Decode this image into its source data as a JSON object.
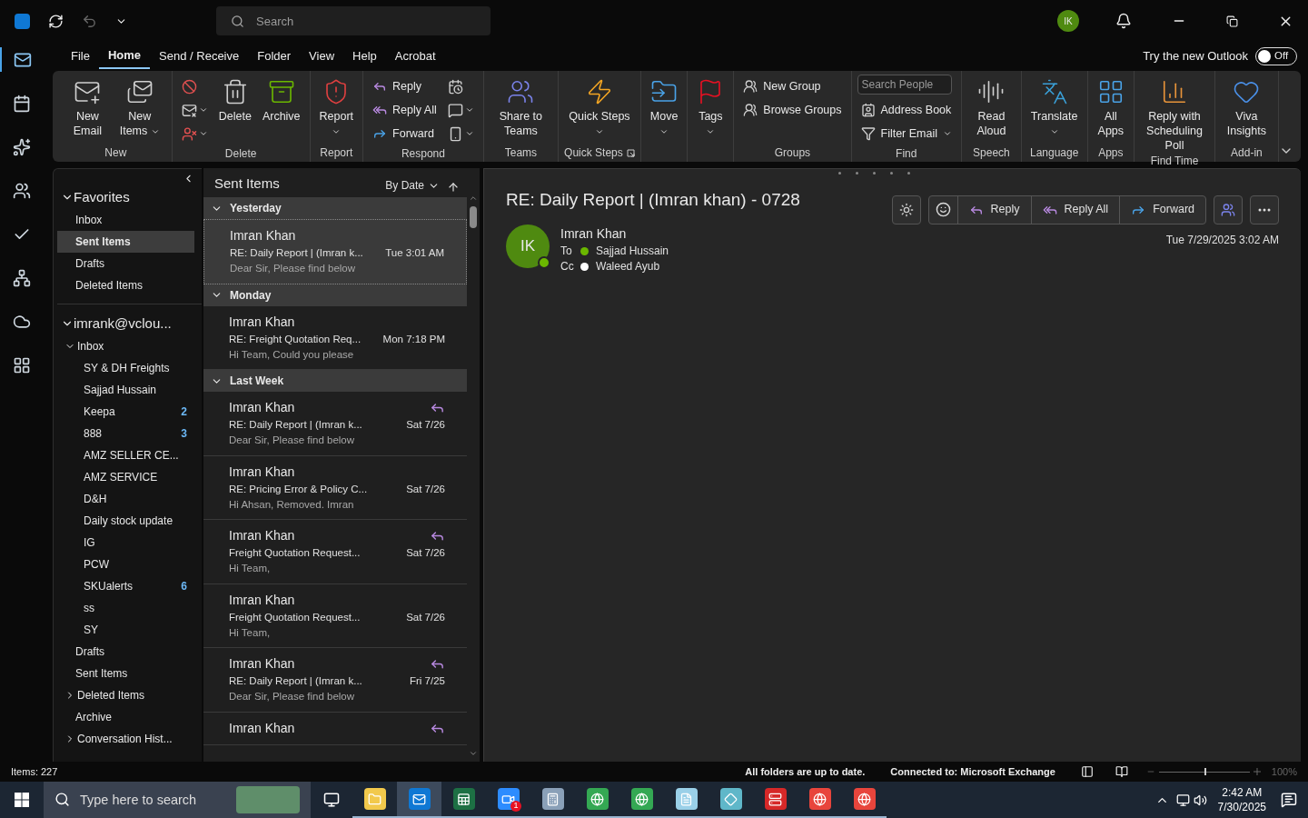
{
  "title_bar": {
    "search_placeholder": "Search",
    "avatar": "IK"
  },
  "menu_tabs": [
    {
      "label": "File",
      "selected": false
    },
    {
      "label": "Home",
      "selected": true
    },
    {
      "label": "Send / Receive",
      "selected": false
    },
    {
      "label": "Folder",
      "selected": false
    },
    {
      "label": "View",
      "selected": false
    },
    {
      "label": "Help",
      "selected": false
    },
    {
      "label": "Acrobat",
      "selected": false
    }
  ],
  "new_outlook_toggle": {
    "label": "Try the new Outlook",
    "state": "Off",
    "on": false
  },
  "ribbon": {
    "groups": [
      {
        "name": "New",
        "columns": [
          [
            {
              "kind": "large",
              "label": "New Email",
              "dropdown": false
            }
          ],
          [
            {
              "kind": "large",
              "label": "New Items",
              "dropdown": true
            }
          ]
        ]
      },
      {
        "name": "Delete",
        "columns": [
          [
            {
              "kind": "icon",
              "dropdown": false
            },
            {
              "kind": "icon",
              "dropdown": true
            },
            {
              "kind": "icon",
              "dropdown": true
            }
          ],
          [
            {
              "kind": "large",
              "label": "Delete",
              "dropdown": false
            }
          ],
          [
            {
              "kind": "large",
              "label": "Archive",
              "dropdown": false
            }
          ]
        ]
      },
      {
        "name": "Report",
        "columns": [
          [
            {
              "kind": "large",
              "label": "Report",
              "dropdown": true
            }
          ]
        ]
      },
      {
        "name": "Respond",
        "columns": [
          [
            {
              "kind": "small",
              "label": "Reply",
              "dropdown": false
            },
            {
              "kind": "small",
              "label": "Reply All",
              "dropdown": false
            },
            {
              "kind": "small",
              "label": "Forward",
              "dropdown": false
            }
          ],
          [
            {
              "kind": "icon",
              "dropdown": false
            },
            {
              "kind": "icon",
              "dropdown": true
            },
            {
              "kind": "icon",
              "dropdown": true
            }
          ]
        ]
      },
      {
        "name": "Teams",
        "columns": [
          [
            {
              "kind": "large",
              "label": "Share to Teams",
              "dropdown": false
            }
          ]
        ]
      },
      {
        "name": "Quick Steps",
        "launcher": true,
        "columns": [
          [
            {
              "kind": "large",
              "label": "Quick Steps",
              "dropdown": true
            }
          ]
        ]
      },
      {
        "columns": [
          [
            {
              "kind": "large",
              "label": "Move",
              "dropdown": true
            }
          ]
        ]
      },
      {
        "columns": [
          [
            {
              "kind": "large",
              "label": "Tags",
              "dropdown": true
            }
          ]
        ]
      },
      {
        "name": "Groups",
        "columns": [
          [
            {
              "kind": "small",
              "label": "New Group",
              "dropdown": false
            },
            {
              "kind": "small",
              "label": "Browse Groups",
              "dropdown": false
            }
          ]
        ]
      },
      {
        "name": "Find",
        "columns": [
          [
            {
              "kind": "field",
              "placeholder": "Search People"
            },
            {
              "kind": "small",
              "label": "Address Book",
              "dropdown": false
            },
            {
              "kind": "small",
              "label": "Filter Email",
              "dropdown": true
            }
          ]
        ]
      },
      {
        "name": "Speech",
        "columns": [
          [
            {
              "kind": "large",
              "label": "Read Aloud",
              "dropdown": false
            }
          ]
        ]
      },
      {
        "name": "Language",
        "columns": [
          [
            {
              "kind": "large",
              "label": "Translate",
              "dropdown": true
            }
          ]
        ]
      },
      {
        "name": "Apps",
        "columns": [
          [
            {
              "kind": "large",
              "label": "All Apps",
              "dropdown": false
            }
          ]
        ]
      },
      {
        "name": "Find Time",
        "columns": [
          [
            {
              "kind": "large",
              "label": "Reply with Scheduling Poll",
              "dropdown": false
            }
          ]
        ]
      },
      {
        "name": "Add-in",
        "columns": [
          [
            {
              "kind": "large",
              "label": "Viva Insights",
              "dropdown": false
            }
          ]
        ]
      }
    ]
  },
  "nav_rail": [
    {
      "selected": true
    },
    {
      "selected": false
    },
    {
      "selected": false
    },
    {
      "selected": false
    },
    {
      "selected": false
    },
    {
      "selected": false
    },
    {
      "selected": false
    },
    {
      "selected": false
    }
  ],
  "folder_pane": {
    "favorites": {
      "label": "Favorites",
      "expanded": true,
      "items": [
        {
          "label": "Inbox",
          "selected": false
        },
        {
          "label": "Sent Items",
          "selected": true
        },
        {
          "label": "Drafts",
          "selected": false
        },
        {
          "label": "Deleted Items",
          "selected": false
        }
      ]
    },
    "account": {
      "label": "imrank@vclou...",
      "expanded": true,
      "folders": [
        {
          "label": "Inbox",
          "expanded": true,
          "selected": false,
          "children": [
            {
              "label": "SY & DH Freights",
              "selected": false
            },
            {
              "label": "Sajjad Hussain",
              "selected": false
            },
            {
              "label": "Keepa",
              "count": "2",
              "selected": false
            },
            {
              "label": "888",
              "count": "3",
              "selected": false
            },
            {
              "label": "AMZ SELLER CE...",
              "selected": false
            },
            {
              "label": "AMZ SERVICE",
              "selected": false
            },
            {
              "label": "D&H",
              "selected": false
            },
            {
              "label": "Daily stock update",
              "selected": false
            },
            {
              "label": "IG",
              "selected": false
            },
            {
              "label": "PCW",
              "selected": false
            },
            {
              "label": "SKUalerts",
              "count": "6",
              "selected": false
            },
            {
              "label": "ss",
              "selected": false
            },
            {
              "label": "SY",
              "selected": false
            }
          ]
        },
        {
          "label": "Drafts",
          "selected": false
        },
        {
          "label": "Sent Items",
          "selected": false
        },
        {
          "label": "Deleted Items",
          "expanded": false,
          "selected": false
        },
        {
          "label": "Archive",
          "selected": false
        },
        {
          "label": "Conversation Hist...",
          "expanded": false,
          "selected": false
        }
      ]
    }
  },
  "message_list": {
    "title": "Sent Items",
    "sort": "By Date",
    "groups": [
      {
        "label": "Yesterday",
        "expanded": true,
        "messages": [
          {
            "sender": "Imran Khan",
            "subject": "RE:  Daily Report | (Imran k...",
            "time": "Tue 3:01 AM",
            "preview": "Dear Sir,  Please find below",
            "replied": false,
            "selected": true
          }
        ]
      },
      {
        "label": "Monday",
        "expanded": true,
        "messages": [
          {
            "sender": "Imran Khan",
            "subject": "RE: Freight Quotation Req...",
            "time": "Mon 7:18 PM",
            "preview": "Hi Team,  Could you please",
            "replied": false,
            "selected": false
          }
        ]
      },
      {
        "label": "Last Week",
        "expanded": true,
        "messages": [
          {
            "sender": "Imran Khan",
            "subject": "RE:  Daily Report | (Imran k...",
            "time": "Sat 7/26",
            "preview": "Dear Sir,  Please find below",
            "replied": true,
            "selected": false
          },
          {
            "sender": "Imran Khan",
            "subject": "RE: Pricing Error & Policy C...",
            "time": "Sat 7/26",
            "preview": "Hi Ahsan,  Removed.  Imran",
            "replied": false,
            "selected": false
          },
          {
            "sender": "Imran Khan",
            "subject": "Freight Quotation Request...",
            "time": "Sat 7/26",
            "preview": "Hi Team,",
            "replied": true,
            "selected": false
          },
          {
            "sender": "Imran Khan",
            "subject": "Freight Quotation Request...",
            "time": "Sat 7/26",
            "preview": "Hi Team,",
            "replied": false,
            "selected": false
          },
          {
            "sender": "Imran Khan",
            "subject": "RE:  Daily Report | (Imran k...",
            "time": "Fri 7/25",
            "preview": "Dear Sir,  Please find below",
            "replied": true,
            "selected": false
          },
          {
            "sender": "Imran Khan",
            "replied": true,
            "selected": false
          }
        ]
      }
    ]
  },
  "reading_pane": {
    "subject": "RE:  Daily Report | (Imran khan) - 0728",
    "avatar": "IK",
    "sender": "Imran Khan",
    "recipients": [
      {
        "label": "To",
        "name": "Sajjad Hussain",
        "color": "#6bb700"
      },
      {
        "label": "Cc",
        "name": "Waleed Ayub",
        "color": "#ffffff"
      }
    ],
    "actions": [
      "Reply",
      "Reply All",
      "Forward"
    ],
    "date": "Tue 7/29/2025 3:02 AM"
  },
  "status_bar": {
    "items": "Items: 227",
    "sync": "All folders are up to date.",
    "connection": "Connected to: Microsoft Exchange",
    "zoom": "100%",
    "level": 0.5
  },
  "taskbar": {
    "search_placeholder": "Type here to search",
    "apps": [
      {
        "active": false
      },
      {
        "active": true
      },
      {
        "active": false
      },
      {
        "active": false,
        "badge": "1"
      },
      {
        "active": false
      },
      {
        "active": false
      },
      {
        "active": false
      },
      {
        "active": false
      },
      {
        "active": false
      },
      {
        "active": false
      },
      {
        "active": false
      },
      {
        "active": false
      }
    ],
    "time": "2:42 AM",
    "date": "7/30/2025"
  }
}
